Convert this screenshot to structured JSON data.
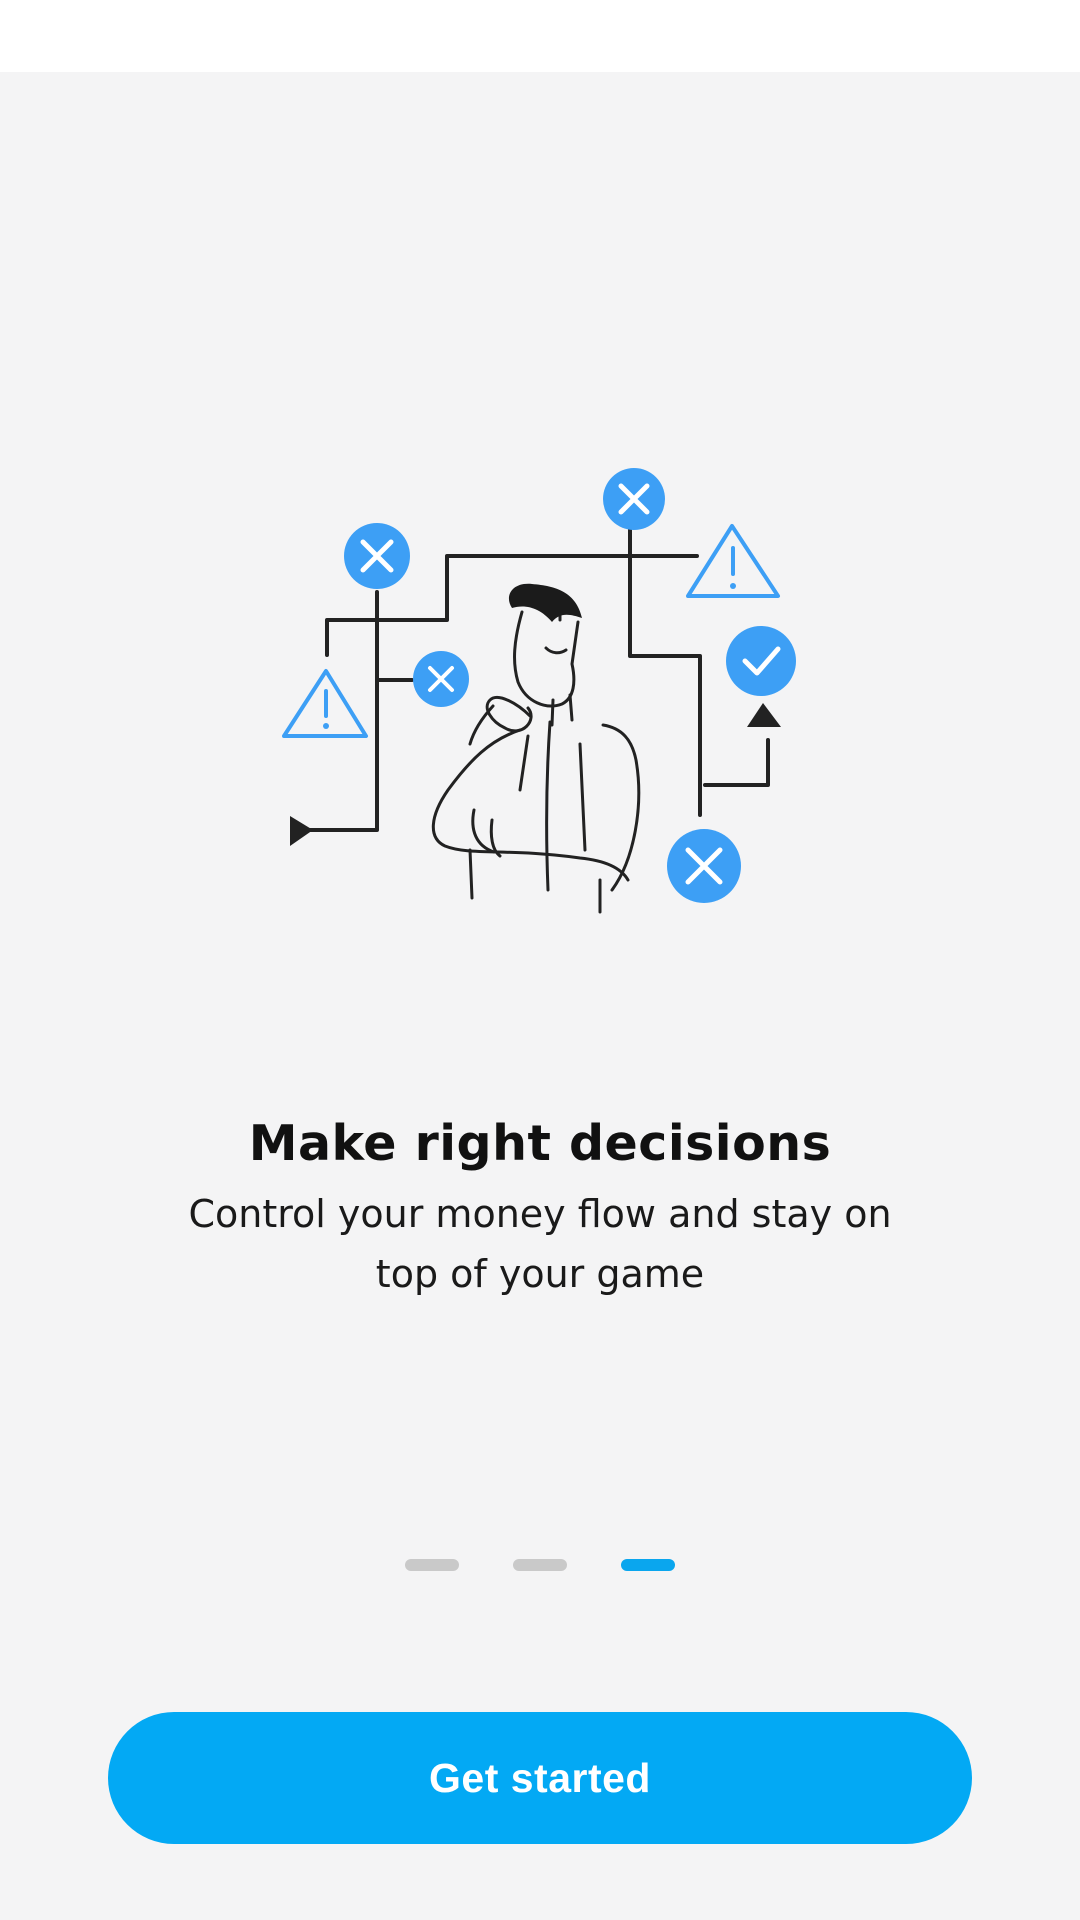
{
  "onboarding": {
    "title": "Make right decisions",
    "subtitle": "Control your money flow and stay on top of your game",
    "illustration": "person-thinking-decision-maze-illustration",
    "pager": {
      "total": 3,
      "active_index": 2
    },
    "cta_label": "Get started"
  },
  "colors": {
    "background": "#f4f4f5",
    "status_bar": "#ffffff",
    "accent": "#03a9f4",
    "illustration_blue": "#3d9ff5",
    "pager_inactive": "#c9c9c9",
    "pager_active": "#0aa6ee"
  },
  "icons": [
    "close-circle-icon",
    "warning-triangle-icon",
    "check-circle-icon",
    "arrow-up-icon",
    "arrow-right-icon"
  ]
}
